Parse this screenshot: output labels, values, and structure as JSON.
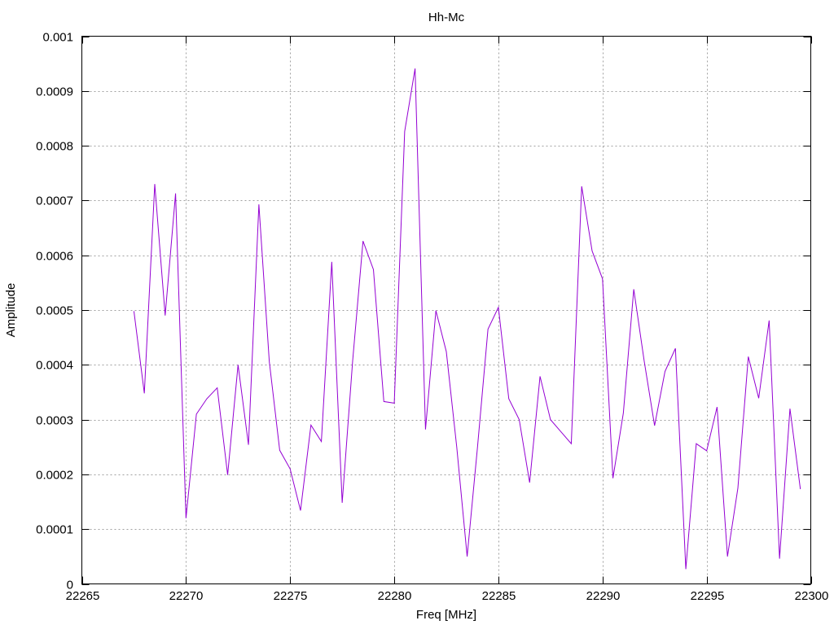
{
  "chart_data": {
    "type": "line",
    "title": "Hh-Mc",
    "xlabel": "Freq [MHz]",
    "ylabel": "Amplitude",
    "xlim": [
      22265,
      22300
    ],
    "ylim": [
      0,
      0.001
    ],
    "xticks": [
      22265,
      22270,
      22275,
      22280,
      22285,
      22290,
      22295,
      22300
    ],
    "yticks": [
      0,
      0.0001,
      0.0002,
      0.0003,
      0.0004,
      0.0005,
      0.0006,
      0.0007,
      0.0008,
      0.0009,
      0.001
    ],
    "ytick_labels": [
      "0",
      "0.0001",
      "0.0002",
      "0.0003",
      "0.0004",
      "0.0005",
      "0.0006",
      "0.0007",
      "0.0008",
      "0.0009",
      "0.001"
    ],
    "grid": true,
    "series": [
      {
        "color": "#9400d3",
        "x": [
          22267.5,
          22268.0,
          22268.5,
          22269.0,
          22269.5,
          22270.0,
          22270.5,
          22271.0,
          22271.5,
          22272.0,
          22272.5,
          22273.0,
          22273.5,
          22274.0,
          22274.5,
          22275.0,
          22275.5,
          22276.0,
          22276.5,
          22277.0,
          22277.5,
          22278.0,
          22278.5,
          22279.0,
          22279.5,
          22280.0,
          22280.5,
          22281.0,
          22281.5,
          22282.0,
          22282.5,
          22283.0,
          22283.5,
          22284.0,
          22284.5,
          22285.0,
          22285.5,
          22286.0,
          22286.5,
          22287.0,
          22287.5,
          22288.0,
          22288.5,
          22289.0,
          22289.5,
          22290.0,
          22290.5,
          22291.0,
          22291.5,
          22292.0,
          22292.5,
          22293.0,
          22293.5,
          22294.0,
          22294.5,
          22295.0,
          22295.5,
          22296.0,
          22296.5,
          22297.0,
          22297.5,
          22298.0,
          22298.5,
          22299.0,
          22299.5
        ],
        "y": [
          0.000498,
          0.000348,
          0.00073,
          0.00049,
          0.000713,
          0.00012,
          0.00031,
          0.000338,
          0.000358,
          0.000199,
          0.0004,
          0.000254,
          0.000693,
          0.000406,
          0.000244,
          0.00021,
          0.000134,
          0.00029,
          0.00026,
          0.000588,
          0.000148,
          0.000406,
          0.000626,
          0.000574,
          0.000333,
          0.00033,
          0.000826,
          0.000941,
          0.000282,
          0.000499,
          0.000424,
          0.00025,
          5e-05,
          0.000251,
          0.000465,
          0.000505,
          0.000338,
          0.0003,
          0.000185,
          0.000379,
          0.0003,
          0.000278,
          0.000256,
          0.000726,
          0.000608,
          0.000557,
          0.000193,
          0.000312,
          0.000538,
          0.000407,
          0.000289,
          0.000388,
          0.00043,
          2.7e-05,
          0.000256,
          0.000243,
          0.000323,
          5e-05,
          0.000175,
          0.000415,
          0.000339,
          0.000481,
          4.6e-05,
          0.00032,
          0.000173
        ]
      }
    ]
  }
}
